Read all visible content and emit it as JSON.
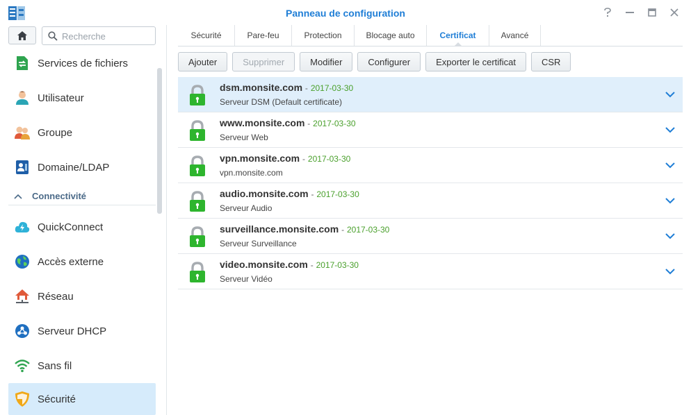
{
  "window": {
    "title": "Panneau de configuration",
    "controls": [
      "help-icon",
      "minimize-icon",
      "maximize-icon",
      "close-icon"
    ]
  },
  "search": {
    "placeholder": "Recherche"
  },
  "sidebar": {
    "items": [
      {
        "label": "Services de fichiers",
        "icon": "file-services-icon"
      },
      {
        "label": "Utilisateur",
        "icon": "user-icon"
      },
      {
        "label": "Groupe",
        "icon": "group-icon"
      },
      {
        "label": "Domaine/LDAP",
        "icon": "domain-ldap-icon"
      }
    ],
    "section": {
      "label": "Connectivité"
    },
    "connectivity_items": [
      {
        "label": "QuickConnect",
        "icon": "quickconnect-icon"
      },
      {
        "label": "Accès externe",
        "icon": "external-access-icon"
      },
      {
        "label": "Réseau",
        "icon": "network-icon"
      },
      {
        "label": "Serveur DHCP",
        "icon": "dhcp-icon"
      },
      {
        "label": "Sans fil",
        "icon": "wifi-icon"
      },
      {
        "label": "Sécurité",
        "icon": "security-shield-icon",
        "active": true
      }
    ]
  },
  "tabs": [
    {
      "label": "Sécurité"
    },
    {
      "label": "Pare-feu"
    },
    {
      "label": "Protection"
    },
    {
      "label": "Blocage auto"
    },
    {
      "label": "Certificat",
      "active": true
    },
    {
      "label": "Avancé"
    }
  ],
  "toolbar": {
    "add": "Ajouter",
    "delete": "Supprimer",
    "edit": "Modifier",
    "configure": "Configurer",
    "export": "Exporter le certificat",
    "csr": "CSR"
  },
  "certificates": [
    {
      "name": "dsm.monsite.com",
      "date": "2017-03-30",
      "description": "Serveur DSM (Default certificate)",
      "selected": true
    },
    {
      "name": "www.monsite.com",
      "date": "2017-03-30",
      "description": "Serveur Web"
    },
    {
      "name": "vpn.monsite.com",
      "date": "2017-03-30",
      "description": "vpn.monsite.com"
    },
    {
      "name": "audio.monsite.com",
      "date": "2017-03-30",
      "description": "Serveur Audio"
    },
    {
      "name": "surveillance.monsite.com",
      "date": "2017-03-30",
      "description": "Serveur Surveillance"
    },
    {
      "name": "video.monsite.com",
      "date": "2017-03-30",
      "description": "Serveur Vidéo"
    }
  ],
  "separator": "-",
  "colors": {
    "accent": "#1f7ed6",
    "date_green": "#4aa02c",
    "lock_green": "#2eb52e",
    "selected_row": "#e0effb"
  }
}
